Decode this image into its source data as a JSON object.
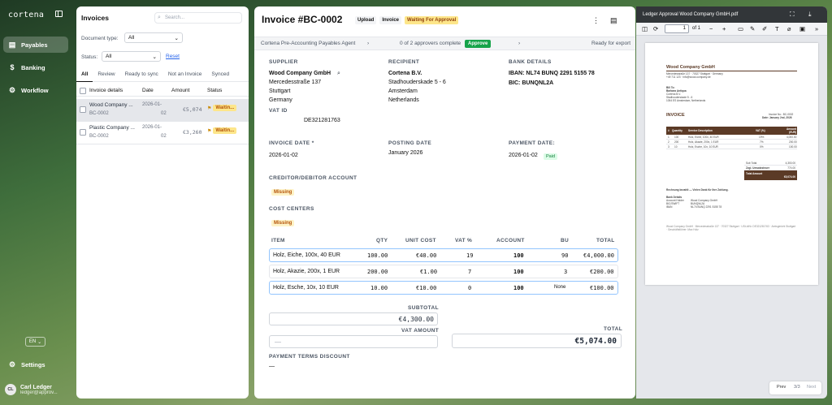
{
  "app": {
    "logo": "cortena"
  },
  "sidebar": {
    "items": [
      {
        "label": "Payables",
        "icon": "document-icon"
      },
      {
        "label": "Banking",
        "icon": "dollar-icon"
      },
      {
        "label": "Workflow",
        "icon": "workflow-icon"
      }
    ],
    "language": "EN",
    "settings_label": "Settings",
    "user": {
      "initials": "CL",
      "name": "Carl Ledger",
      "email": "ledger@approv..."
    }
  },
  "list": {
    "title": "Invoices",
    "search_placeholder": "Search...",
    "doc_type_label": "Document type:",
    "doc_type_value": "All",
    "status_label": "Status:",
    "status_value": "All",
    "reset_label": "Reset",
    "tabs": [
      "All",
      "Review",
      "Ready to sync",
      "Not an Invoice",
      "Synced"
    ],
    "columns": [
      "Invoice details",
      "Date",
      "Amount",
      "Status"
    ],
    "rows": [
      {
        "name": "Wood Company ...",
        "id": "BC-0002",
        "date1": "2026-01-",
        "date2": "02",
        "amount": "€5,074",
        "status": "Waitin..."
      },
      {
        "name": "Plastic Company ...",
        "id": "BC-0002",
        "date1": "2026-01-",
        "date2": "02",
        "amount": "€3,260",
        "status": "Waitin..."
      }
    ]
  },
  "invoice": {
    "title": "Invoice #BC-0002",
    "badges": [
      "Upload",
      "Invoice",
      "Waiting For Approval"
    ],
    "agent": "Cortena Pre-Accounting Payables Agent",
    "approvers": "0 of 2 approvers complete",
    "approve_label": "Approve",
    "ready": "Ready for export",
    "supplier_label": "SUPPLIER",
    "supplier": {
      "name": "Wood Company GmbH",
      "street": "Mercedesstraße 137",
      "city": "Stuttgart",
      "country": "Germany"
    },
    "vat_id_label": "VAT ID",
    "vat_id": "DE321281763",
    "recipient_label": "RECIPIENT",
    "recipient": {
      "name": "Cortena B.V.",
      "street": "Stadhouderskade 5 - 6",
      "city": "Amsterdam",
      "country": "Netherlands"
    },
    "bank_label": "BANK DETAILS",
    "iban": "IBAN: NL74 BUNQ 2291 5155 78",
    "bic": "BIC: BUNQNL2A",
    "invoice_date_label": "INVOICE DATE *",
    "invoice_date": "2026-01-02",
    "posting_date_label": "POSTING DATE",
    "posting_date": "January 2026",
    "payment_date_label": "PAYMENT DATE:",
    "payment_date": "2026-01-02",
    "paid_label": "Paid",
    "creditor_label": "CREDITOR/DEBITOR ACCOUNT",
    "missing_label": "Missing",
    "cost_centers_label": "COST CENTERS",
    "item_columns": [
      "ITEM",
      "QTY",
      "UNIT COST",
      "VAT %",
      "ACCOUNT",
      "BU",
      "TOTAL"
    ],
    "items": [
      {
        "item": "Holz, Eiche, 100x, 40 EUR",
        "qty": "100.00",
        "unit": "€40.00",
        "vat": "19",
        "account": "100",
        "bu": "90",
        "total": "€4,000.00"
      },
      {
        "item": "Holz, Akazie, 200x, 1 EUR",
        "qty": "200.00",
        "unit": "€1.00",
        "vat": "7",
        "account": "100",
        "bu": "3",
        "total": "€200.00"
      },
      {
        "item": "Holz, Esche, 10x, 10 EUR",
        "qty": "10.00",
        "unit": "€10.00",
        "vat": "0",
        "account": "100",
        "bu": "None",
        "total": "€100.00"
      }
    ],
    "subtotal_label": "SUBTOTAL",
    "subtotal": "€4,300.00",
    "vat_amount_label": "VAT AMOUNT",
    "vat_amount": "—",
    "total_label": "TOTAL",
    "total": "€5,074.00",
    "discount_label": "PAYMENT TERMS DISCOUNT",
    "discount": "—"
  },
  "pdf": {
    "title": "Ledger Approval Wood Company GmbH.pdf",
    "page_input": "1",
    "page_of": "of 1",
    "prev": "Prev",
    "count": "3/3",
    "next": "Next",
    "doc": {
      "company": "Wood Company GmbH",
      "address_line": "Mercedesstraße 137 · 70327 Stuttgart · Germany",
      "contact_line": "+49 711 123 · info@wood-company.de",
      "bill_to": "Bill To:",
      "bill_name": "Barbara Antiqua",
      "bill_company": "Cortena B.V.",
      "bill_street": "Stadhouderskade 5 - 6",
      "bill_city": "1054 ES Amsterdam, Netherlands",
      "invoice_word": "INVOICE",
      "inv_no": "Invoice No.: BC-0002",
      "inv_date": "Date: January 2nd, 2026",
      "headers": [
        "#",
        "Quantity",
        "Service Description",
        "VAT (%)",
        "Amount (EUR)"
      ],
      "rows": [
        [
          "1",
          "100",
          "Holz, Eiche, 100x, 40 EUR",
          "19%",
          "4,000.00"
        ],
        [
          "2",
          "200",
          "Holz, Akazie, 200x, 1 EUR",
          "7%",
          "200.00"
        ],
        [
          "3",
          "10",
          "Holz, Esche, 10x, 10 EUR",
          "0%",
          "100.00"
        ]
      ],
      "sub_total_label": "Sub Total",
      "sub_total": "4,300.00",
      "vat_label": "Zzgl. Umsatzsteuer",
      "vat": "774.00",
      "total_label": "Total Amount",
      "total": "€5,074.00",
      "remarks": "Rechnung bezahlt — Vielen Dank für Ihre Zahlung.",
      "bank_title": "Bank Details",
      "holder_label": "Account Holder",
      "holder": "Wood Company GmbH",
      "bic_label": "BIC/SWIFT",
      "bic": "BUNQNL2A",
      "iban_label": "IBAN",
      "iban": "NL74 BUNQ 2291 5155 78",
      "footer": "Wood Company GmbH · Mercedesstraße 137 · 70327 Stuttgart · USt-IdNr. DE321281763 · Amtsgericht Stuttgart · Geschäftsführer: Max Holz"
    }
  },
  "colors": {
    "accent_green": "#16a34a",
    "warning": "#fde68a",
    "pdf_table_header": "#5b3a26"
  }
}
